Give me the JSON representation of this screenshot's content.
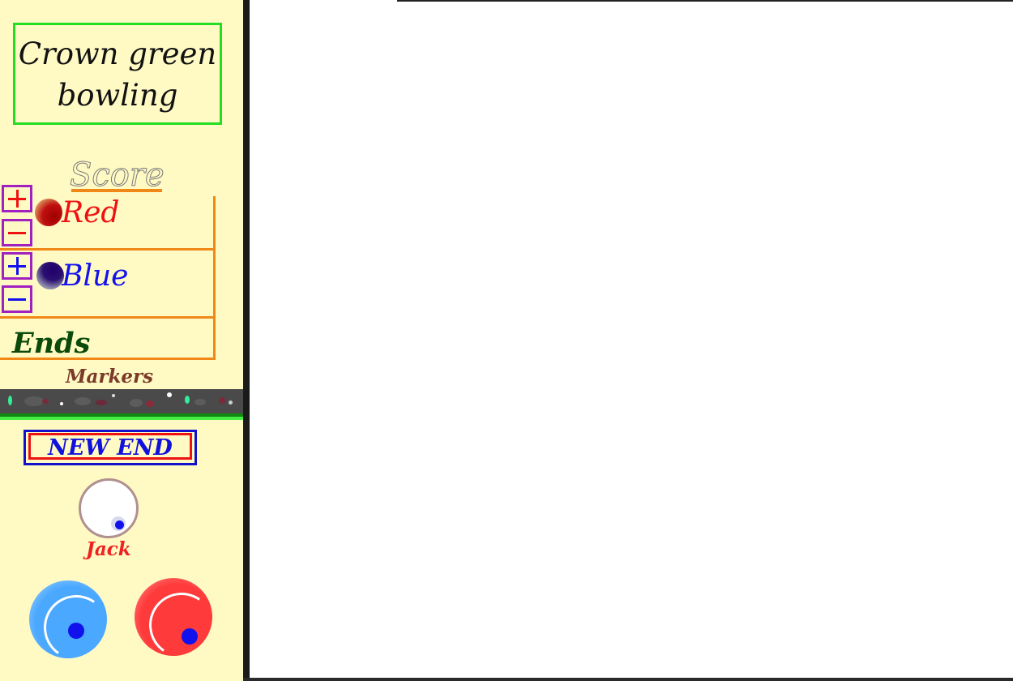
{
  "title": {
    "line1": "Crown green",
    "line2": "bowling"
  },
  "score": {
    "heading": "Score"
  },
  "teams": {
    "red": {
      "label": "Red",
      "plus_icon": "plus-icon",
      "minus_icon": "minus-icon",
      "color": "#ee1111"
    },
    "blue": {
      "label": "Blue",
      "plus_icon": "plus-icon",
      "minus_icon": "minus-icon",
      "color": "#1111ee"
    }
  },
  "ends": {
    "label": "Ends"
  },
  "markers": {
    "label": "Markers"
  },
  "controls": {
    "new_end_label": "NEW END"
  },
  "jack": {
    "label": "Jack"
  },
  "bowls": {
    "blue_color": "#4aa8ff",
    "red_color": "#ff3a3a"
  },
  "colors": {
    "panel_bg": "#fffac4",
    "accent_orange": "#f08818",
    "title_border": "#22dd22",
    "button_border": "#a020c0"
  }
}
